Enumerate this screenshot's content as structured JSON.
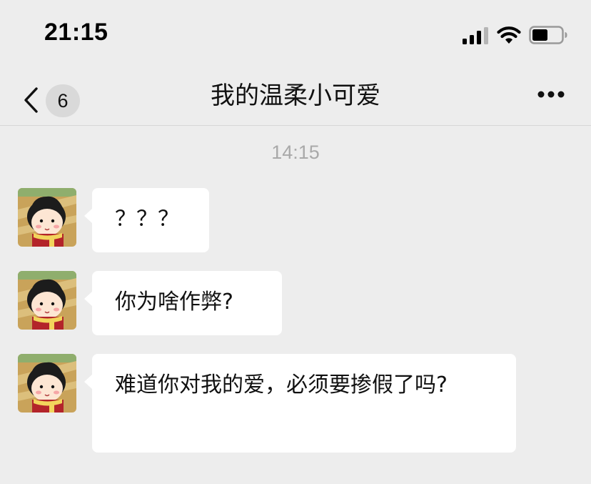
{
  "status_bar": {
    "time": "21:15",
    "icons": [
      "signal-icon",
      "wifi-icon",
      "battery-icon"
    ]
  },
  "nav": {
    "back_icon": "chevron-left-icon",
    "unread_count": "6",
    "title": "我的温柔小可爱",
    "more_icon": "more-dots-icon"
  },
  "timestamp": "14:15",
  "messages": [
    {
      "sender": "other",
      "avatar_icon": "avatar",
      "text": "？？？"
    },
    {
      "sender": "other",
      "avatar_icon": "avatar",
      "text": "你为啥作弊?"
    },
    {
      "sender": "other",
      "avatar_icon": "avatar",
      "text": "难道你对我的爱，必须要掺假了吗?"
    }
  ],
  "colors": {
    "background": "#ededed",
    "bubble": "#ffffff",
    "timestamp": "#a9a9a9",
    "badge": "#d9d9d9"
  }
}
